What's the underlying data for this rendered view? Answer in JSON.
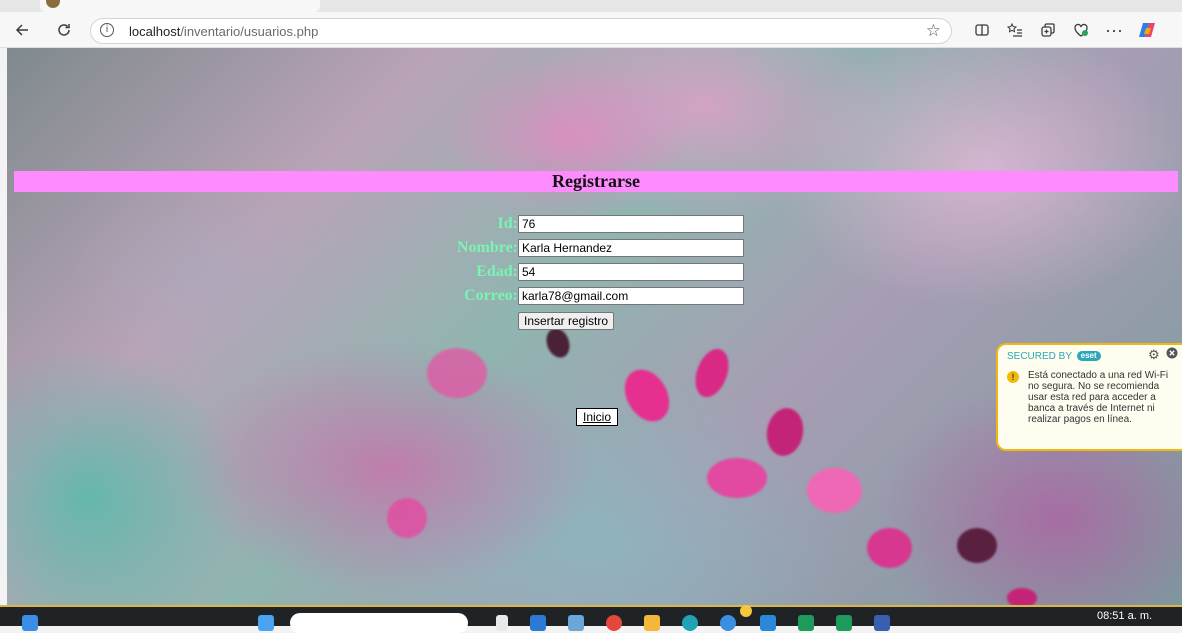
{
  "browser": {
    "url_host": "localhost",
    "url_path": "/inventario/usuarios.php",
    "icons": {
      "back": "back-arrow-icon",
      "reload": "reload-icon",
      "info": "info-icon",
      "favorite": "star-icon",
      "split": "split-screen-icon",
      "favorites": "favorites-list-icon",
      "collections": "collections-icon",
      "health": "browser-essentials-icon",
      "more": "more-icon",
      "copilot": "copilot-icon"
    },
    "info_glyph": "i",
    "more_glyph": "···"
  },
  "page": {
    "title": "Registrarse",
    "form": {
      "id_label": "Id:",
      "id_value": "76",
      "nombre_label": "Nombre:",
      "nombre_value": "Karla Hernandez",
      "edad_label": "Edad:",
      "edad_value": "54",
      "correo_label": "Correo:",
      "correo_value": "karla78@gmail.com",
      "submit_label": "Insertar registro"
    },
    "home_link": "Inicio",
    "colors": {
      "header_bar": "#ff8cff",
      "label_text": "#7df2b5"
    }
  },
  "eset": {
    "secured_by": "SECURED BY",
    "brand": "eset",
    "warning_glyph": "!",
    "message": "Está conectado a una red Wi-Fi no segura. No se recomienda usar esta red para acceder a banca a través de Internet ni realizar pagos en línea.",
    "accent": "#f0b90b"
  },
  "taskbar": {
    "clock": "08:51 a. m."
  }
}
